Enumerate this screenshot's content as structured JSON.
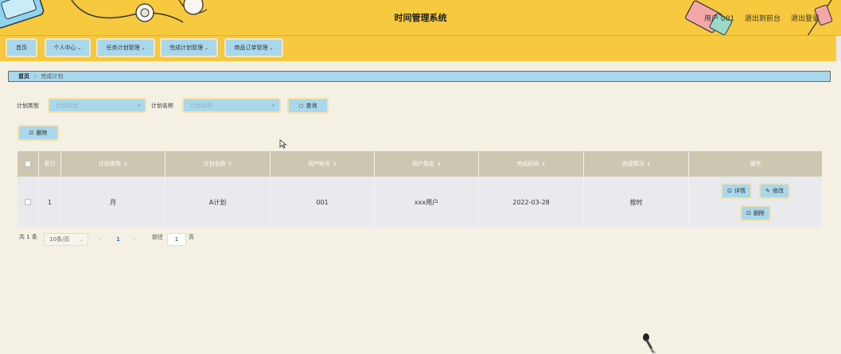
{
  "header": {
    "title": "时间管理系统",
    "user": "用户 001",
    "back_front": "退出到前台",
    "logout": "退出登录"
  },
  "nav": {
    "items": [
      {
        "label": "首页",
        "dropdown": false
      },
      {
        "label": "个人中心",
        "dropdown": true
      },
      {
        "label": "任务计划管理",
        "dropdown": true
      },
      {
        "label": "完成计划管理",
        "dropdown": true
      },
      {
        "label": "商品订单管理",
        "dropdown": true
      }
    ]
  },
  "breadcrumb": {
    "home": "首页",
    "separator": "/",
    "current": "完成计划"
  },
  "search": {
    "type_label": "计划类型",
    "type_placeholder": "计划类型",
    "name_label": "计划名称",
    "name_placeholder": "计划名称",
    "query_button": "查询"
  },
  "toolbar": {
    "delete_button": "删除"
  },
  "table": {
    "headers": [
      "索引",
      "计划类型",
      "计划名称",
      "用户账号",
      "用户姓名",
      "完成时间",
      "完成情况",
      "操作"
    ],
    "rows": [
      {
        "index": "1",
        "plan_type": "月",
        "plan_name": "A计划",
        "user_account": "001",
        "user_name": "xxx用户",
        "finish_time": "2022-03-28",
        "status": "按时"
      }
    ],
    "actions": {
      "detail": "详情",
      "edit": "修改",
      "delete": "删除"
    }
  },
  "pagination": {
    "total": "共 1 条",
    "page_size": "10条/页",
    "current_page": "1",
    "goto_label": "前往",
    "goto_value": "1",
    "page_suffix": "页"
  },
  "colors": {
    "header_bg": "#f6c93e",
    "button_bg": "#a9d7ec",
    "table_head_bg": "#cdc7b1",
    "page_bg": "#f4f0e4",
    "accent_page": "#2f7fb8"
  }
}
